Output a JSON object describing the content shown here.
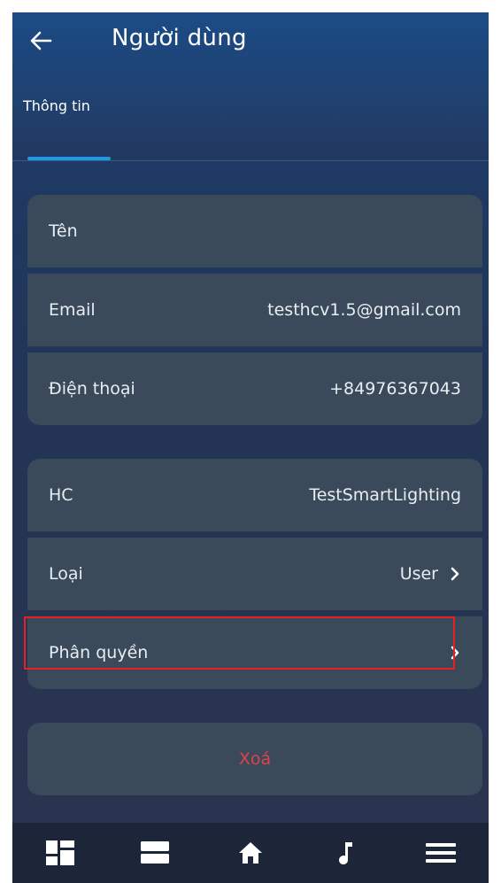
{
  "header": {
    "title": "Người dùng",
    "back_icon": "arrow-left-icon"
  },
  "tabs": [
    {
      "label": "Thông tin",
      "active": true
    }
  ],
  "info_card": {
    "rows": [
      {
        "label": "Tên",
        "value": ""
      },
      {
        "label": "Email",
        "value": "testhcv1.5@gmail.com"
      },
      {
        "label": "Điện thoại",
        "value": "+84976367043"
      }
    ]
  },
  "access_card": {
    "rows": [
      {
        "label": "HC",
        "value": "TestSmartLighting"
      },
      {
        "label": "Loại",
        "value": "User"
      },
      {
        "label": "Phân quyền",
        "value": ""
      }
    ]
  },
  "delete_button": {
    "label": "Xoá"
  },
  "bottom_nav": [
    {
      "icon": "dashboard-icon"
    },
    {
      "icon": "rooms-icon"
    },
    {
      "icon": "home-icon"
    },
    {
      "icon": "music-icon"
    },
    {
      "icon": "menu-icon"
    }
  ],
  "colors": {
    "accent": "#1e9be8",
    "delete_text": "#e0414a",
    "row_background": "#3a4a5b",
    "highlight": "#e52121"
  }
}
